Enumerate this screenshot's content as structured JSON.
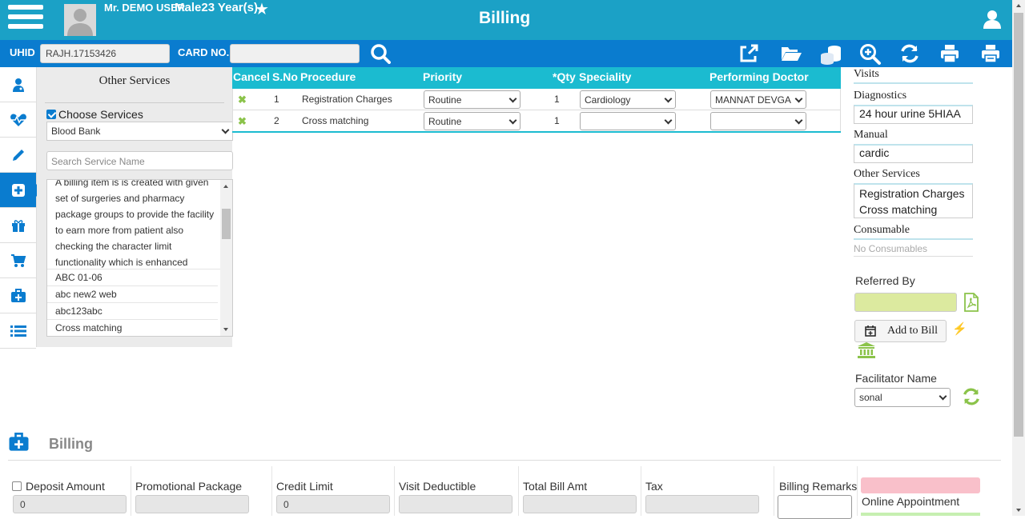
{
  "header": {
    "patient_name": "Mr. DEMO USER",
    "patient_info": "Male23 Year(s)",
    "page_title": "Billing"
  },
  "toolbar": {
    "uhid_label": "UHID",
    "uhid_value": "RAJH.17153426",
    "card_label": "CARD NO.",
    "card_value": ""
  },
  "services_panel": {
    "title": "Other Services",
    "choose_label": "Choose Services",
    "choose_checked": true,
    "category": "Blood Bank",
    "search_placeholder": "Search Service Name",
    "description": "A billing item is is created with given set of surgeries and pharmacy package groups to provide the facility to earn more from patient also checking the character limit functionality which is enhanced",
    "items": [
      "ABC 01-06",
      "abc new2 web",
      "abc123abc",
      "Cross matching"
    ]
  },
  "procedure_table": {
    "headers": {
      "cancel": "Cancel",
      "sno": "S.No",
      "procedure": "Procedure",
      "priority": "Priority",
      "qty": "*Qty",
      "speciality": "Speciality",
      "doctor": "Performing Doctor"
    },
    "rows": [
      {
        "sno": "1",
        "procedure": "Registration Charges",
        "priority": "Routine",
        "qty": "1",
        "speciality": "Cardiology",
        "doctor": "MANNAT DEVGA"
      },
      {
        "sno": "2",
        "procedure": "Cross matching",
        "priority": "Routine",
        "qty": "1",
        "speciality": "",
        "doctor": ""
      }
    ]
  },
  "summary": {
    "visits_label": "Visits",
    "diagnostics_label": "Diagnostics",
    "diagnostics_value": "24 hour urine 5HIAA",
    "manual_label": "Manual",
    "manual_value": "cardic",
    "other_label": "Other Services",
    "other_items": [
      "Registration Charges",
      "Cross matching"
    ],
    "consumable_label": "Consumable",
    "consumable_value": "No Consumables"
  },
  "actions": {
    "referred_by_label": "Referred By",
    "add_to_bill_label": "Add to Bill",
    "facilitator_label": "Facilitator Name",
    "facilitator_value": "sonal"
  },
  "billing": {
    "title": "Billing",
    "deposit_label": "Deposit Amount",
    "deposit_value": "0",
    "promo_label": "Promotional Package",
    "promo_value": "",
    "credit_label": "Credit Limit",
    "credit_value": "0",
    "visit_ded_label": "Visit Deductible",
    "visit_ded_value": "",
    "total_label": "Total Bill Amt",
    "total_value": "",
    "tax_label": "Tax",
    "tax_value": "",
    "remarks_label": "Billing Remarks",
    "online_label": "Online Appointment"
  },
  "colors": {
    "header_bg": "#1ba1c6",
    "toolbar_bg": "#0a7ccf",
    "table_head_bg": "#1bbbd0",
    "accent_green": "#8bc34a"
  }
}
